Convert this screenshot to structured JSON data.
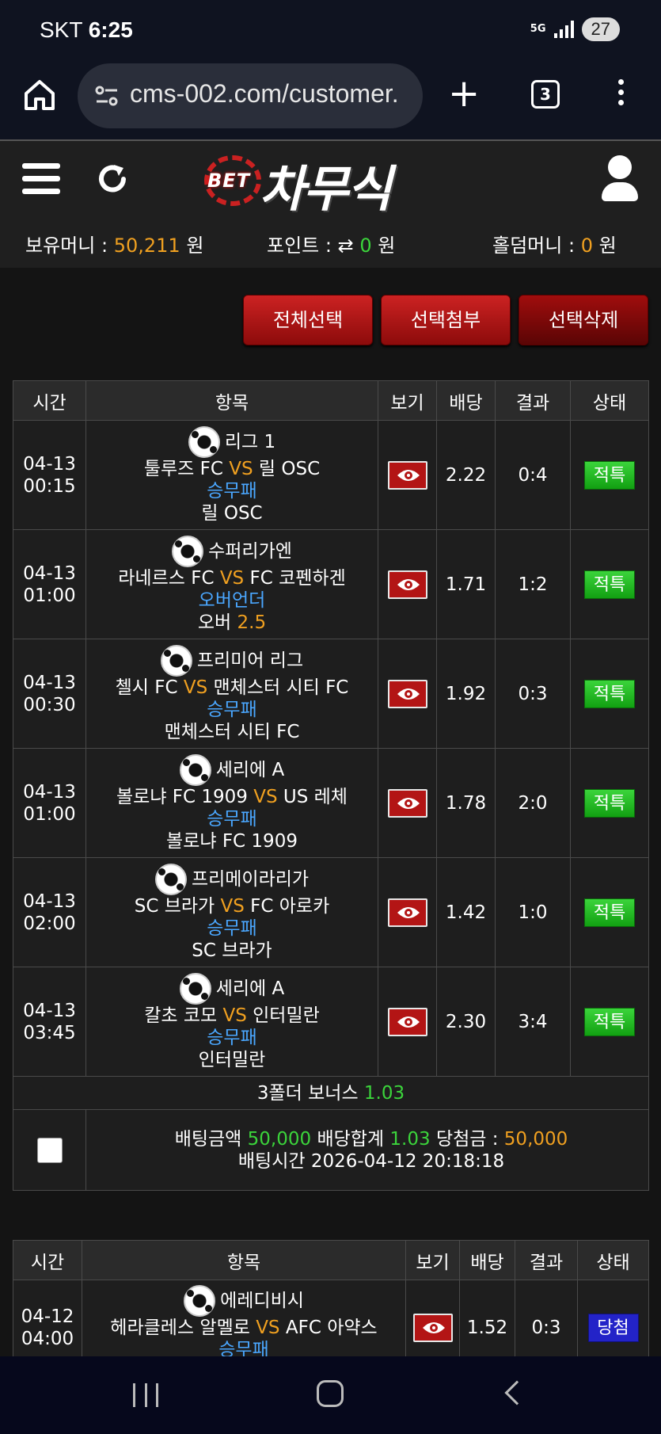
{
  "status": {
    "carrier": "SKT",
    "time": "6:25",
    "network": "5G",
    "battery": "27"
  },
  "browser": {
    "url": "cms-002.com/customer.",
    "tab_count": "3"
  },
  "site": {
    "logo_prefix": "BET",
    "logo_name": "차무식",
    "wallet": {
      "money_label": "보유머니 :",
      "money_value": "50,211",
      "money_unit": "원",
      "point_label": "포인트 :",
      "point_value": "0",
      "point_unit": "원",
      "holdem_label": "홀덤머니 :",
      "holdem_value": "0",
      "holdem_unit": "원"
    }
  },
  "actions": {
    "select_all": "전체선택",
    "attach": "선택첨부",
    "delete": "선택삭제"
  },
  "table1": {
    "headers": [
      "시간",
      "항목",
      "보기",
      "배당",
      "결과",
      "상태"
    ],
    "rows": [
      {
        "date": "04-13",
        "time": "00:15",
        "league": "리그 1",
        "home": "툴루즈 FC",
        "vs": "VS",
        "away": "릴 OSC",
        "market": "승무패",
        "pick": "릴 OSC",
        "pick_extra": "",
        "odds": "2.22",
        "result": "0:4",
        "status": "적특"
      },
      {
        "date": "04-13",
        "time": "01:00",
        "league": "수퍼리가엔",
        "home": "라네르스 FC",
        "vs": "VS",
        "away": "FC 코펜하겐",
        "market": "오버언더",
        "pick": "오버",
        "pick_extra": "2.5",
        "odds": "1.71",
        "result": "1:2",
        "status": "적특"
      },
      {
        "date": "04-13",
        "time": "00:30",
        "league": "프리미어 리그",
        "home": "첼시 FC",
        "vs": "VS",
        "away": "맨체스터 시티 FC",
        "market": "승무패",
        "pick": "맨체스터 시티 FC",
        "pick_extra": "",
        "odds": "1.92",
        "result": "0:3",
        "status": "적특"
      },
      {
        "date": "04-13",
        "time": "01:00",
        "league": "세리에 A",
        "home": "볼로냐 FC 1909",
        "vs": "VS",
        "away": "US 레체",
        "market": "승무패",
        "pick": "볼로냐 FC 1909",
        "pick_extra": "",
        "odds": "1.78",
        "result": "2:0",
        "status": "적특"
      },
      {
        "date": "04-13",
        "time": "02:00",
        "league": "프리메이라리가",
        "home": "SC 브라가",
        "vs": "VS",
        "away": "FC 아로카",
        "market": "승무패",
        "pick": "SC 브라가",
        "pick_extra": "",
        "odds": "1.42",
        "result": "1:0",
        "status": "적특"
      },
      {
        "date": "04-13",
        "time": "03:45",
        "league": "세리에 A",
        "home": "칼초 코모",
        "vs": "VS",
        "away": "인터밀란",
        "market": "승무패",
        "pick": "인터밀란",
        "pick_extra": "",
        "odds": "2.30",
        "result": "3:4",
        "status": "적특"
      }
    ],
    "bonus_label": "3폴더 보너스",
    "bonus_value": "1.03",
    "summary": {
      "amount_label": "배팅금액",
      "amount_value": "50,000",
      "odds_label": "배당합계",
      "odds_value": "1.03",
      "win_label": "당첨금 :",
      "win_value": "50,000",
      "time_label": "배팅시간",
      "time_value": "2026-04-12 20:18:18"
    }
  },
  "table2": {
    "headers": [
      "시간",
      "항목",
      "보기",
      "배당",
      "결과",
      "상태"
    ],
    "rows": [
      {
        "date": "04-12",
        "time": "04:00",
        "league": "에레디비시",
        "home": "헤라클레스 알멜로",
        "vs": "VS",
        "away": "AFC 아약스",
        "market": "승무패",
        "odds": "1.52",
        "result": "0:3",
        "status": "당첨"
      }
    ]
  }
}
